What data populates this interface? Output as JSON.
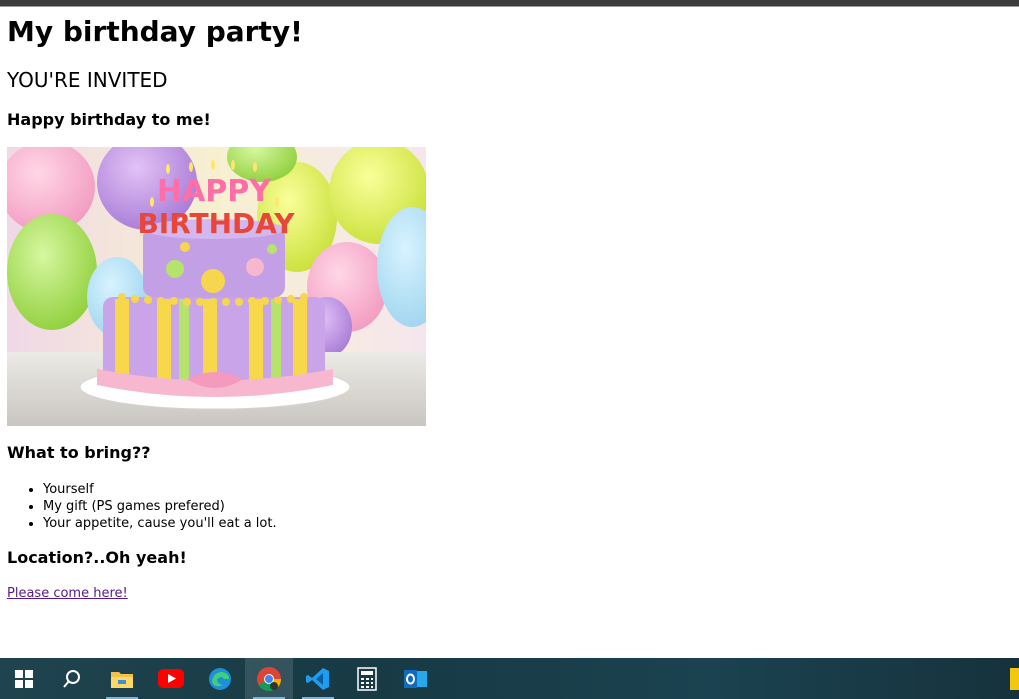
{
  "page": {
    "title": "My birthday party!",
    "invited": "YOU'RE INVITED",
    "subtitle": "Happy birthday to me!",
    "bring_heading": "What to bring??",
    "bring_items": [
      "Yourself",
      "My gift (PS games prefered)",
      "Your appetite, cause you'll eat a lot."
    ],
    "location_heading": "Location?..Oh yeah!",
    "location_link": "Please come here!"
  },
  "cake_image": {
    "candle_text": "HAPPY BIRTHDAY"
  },
  "taskbar": {
    "items": [
      "start-icon",
      "search-icon",
      "file-explorer-icon",
      "youtube-icon",
      "edge-icon",
      "chrome-icon",
      "vscode-icon",
      "calculator-icon",
      "outlook-icon"
    ]
  }
}
